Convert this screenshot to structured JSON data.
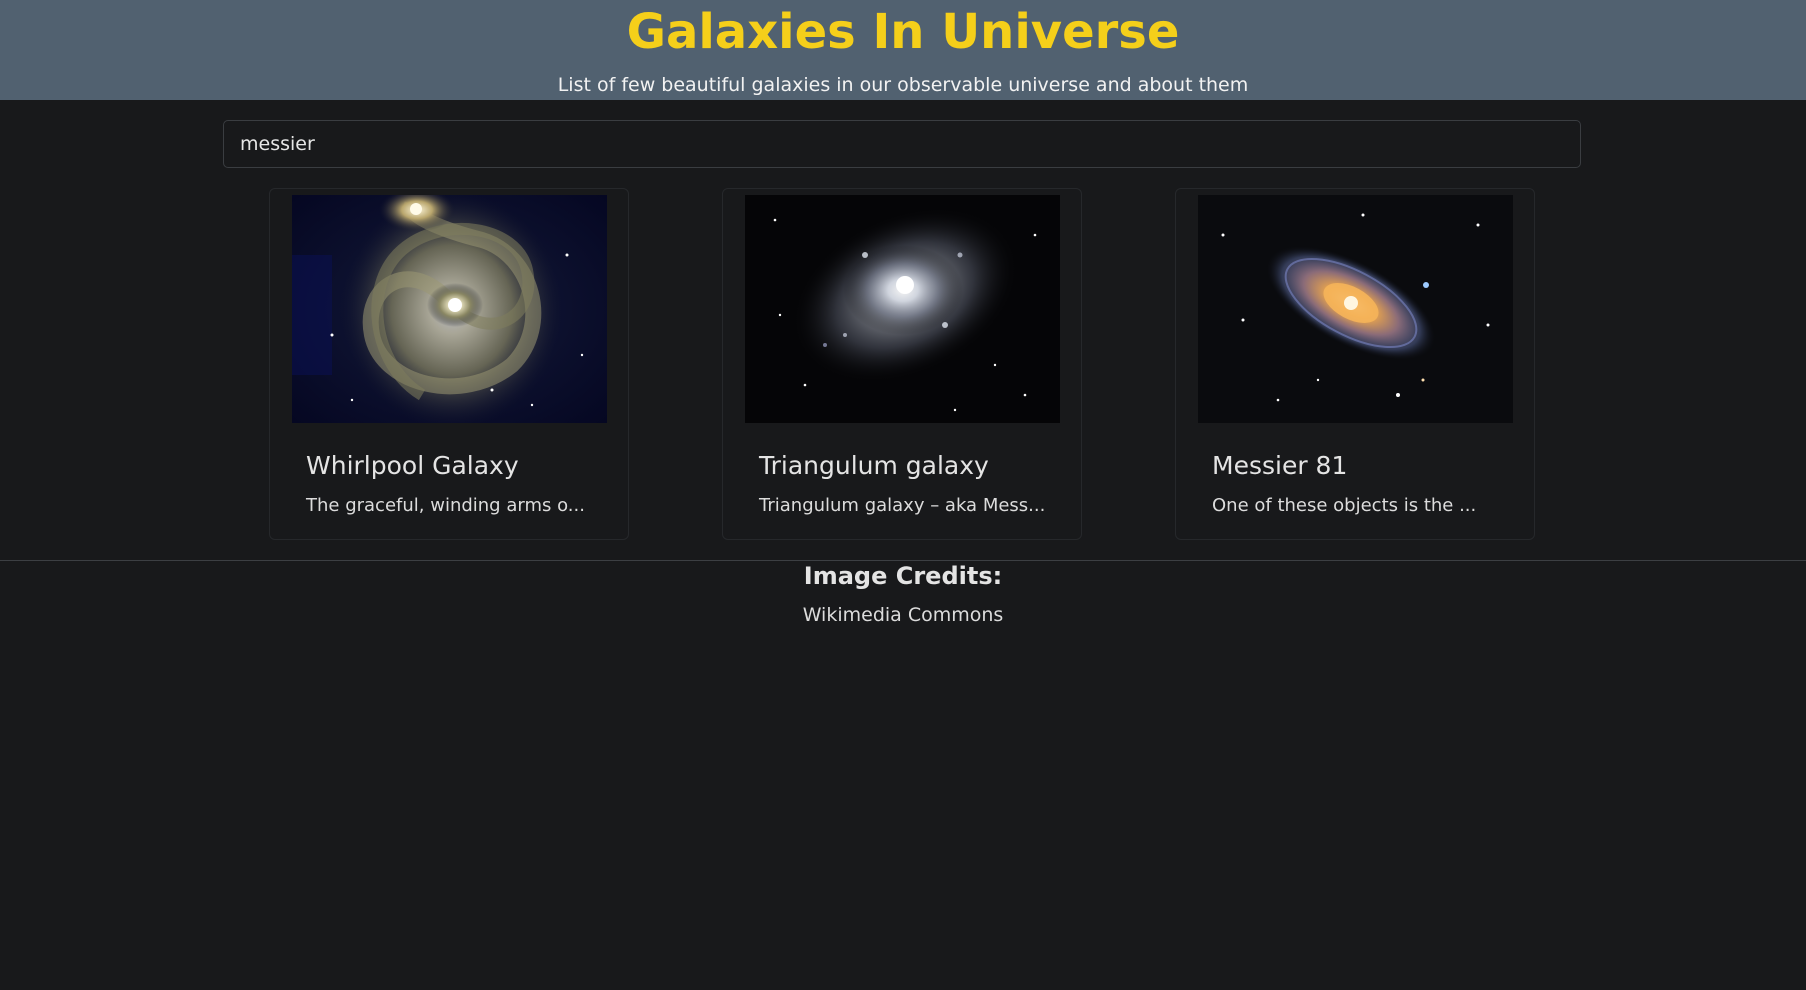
{
  "header": {
    "title": "Galaxies In Universe",
    "subtitle": "List of few beautiful galaxies in our observable universe and about them"
  },
  "search": {
    "value": "messier"
  },
  "cards": [
    {
      "title": "Whirlpool Galaxy",
      "description": "The graceful, winding arms o..."
    },
    {
      "title": "Triangulum galaxy",
      "description": "Triangulum galaxy – aka Mess..."
    },
    {
      "title": "Messier 81",
      "description": "One of these objects is the ..."
    }
  ],
  "footer": {
    "credits_title": "Image Credits:",
    "credits_source": "Wikimedia Commons"
  },
  "colors": {
    "header_bg": "#516170",
    "title": "#f5cf1a",
    "page_bg": "#18191b"
  }
}
